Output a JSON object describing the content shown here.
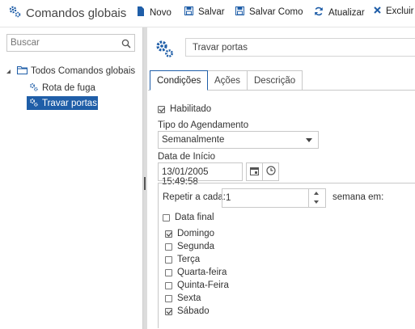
{
  "app": {
    "title": "Comandos globais"
  },
  "toolbar": {
    "new_label": "Novo",
    "save_label": "Salvar",
    "save_as_label": "Salvar Como",
    "refresh_label": "Atualizar",
    "delete_label": "Excluir"
  },
  "sidebar": {
    "search_placeholder": "Buscar",
    "tree": {
      "root_label": "Todos Comandos globais",
      "items": [
        {
          "label": "Rota de fuga",
          "selected": false
        },
        {
          "label": "Travar portas",
          "selected": true
        }
      ]
    }
  },
  "editor": {
    "name_value": "Travar portas",
    "tabs": [
      {
        "label": "Condições",
        "active": true
      },
      {
        "label": "Ações",
        "active": false
      },
      {
        "label": "Descrição",
        "active": false
      }
    ],
    "enabled_label": "Habilitado",
    "enabled_checked": true,
    "schedule_type_label": "Tipo do Agendamento",
    "schedule_type_value": "Semanalmente",
    "start_date_label": "Data de Início",
    "start_date_value": "13/01/2005 15:49:58",
    "repeat_label": "Repetir a cada:",
    "repeat_value": "1",
    "week_on_label": "semana em:",
    "end_date_label": "Data final",
    "end_date_checked": false,
    "days": [
      {
        "label": "Domingo",
        "checked": true
      },
      {
        "label": "Segunda",
        "checked": false
      },
      {
        "label": "Terça",
        "checked": false
      },
      {
        "label": "Quarta-feira",
        "checked": false
      },
      {
        "label": "Quinta-Feira",
        "checked": false
      },
      {
        "label": "Sexta",
        "checked": false
      },
      {
        "label": "Sábado",
        "checked": true
      }
    ]
  },
  "colors": {
    "accent": "#1f5ea8",
    "selection": "#1f5ea8"
  }
}
